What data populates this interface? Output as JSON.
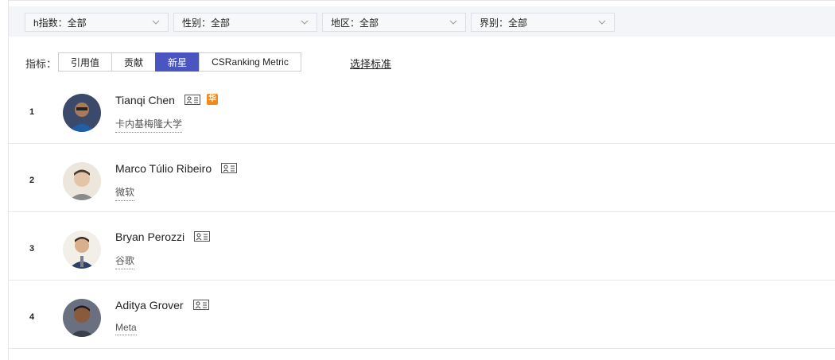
{
  "filters": [
    {
      "label": "h指数：全部"
    },
    {
      "label": "性别：全部"
    },
    {
      "label": "地区：全部"
    },
    {
      "label": "界别：全部"
    }
  ],
  "metric": {
    "label": "指标：",
    "tabs": [
      "引用值",
      "贡献",
      "新星",
      "CSRanking Metric"
    ],
    "active": "新星"
  },
  "choose_label": "选择标准",
  "people": [
    {
      "rank": "1",
      "name": "Tianqi Chen",
      "org": "卡内基梅隆大学",
      "badge": true,
      "badge_text": "华",
      "avatar_color": "#3b4a6b"
    },
    {
      "rank": "2",
      "name": "Marco Túlio Ribeiro",
      "org": "微软",
      "badge": false,
      "avatar_color": "#d8cbbf"
    },
    {
      "rank": "3",
      "name": "Bryan Perozzi",
      "org": "谷歌",
      "badge": false,
      "avatar_color": "#e0ddd6"
    },
    {
      "rank": "4",
      "name": "Aditya Grover",
      "org": "Meta",
      "badge": false,
      "avatar_color": "#6a7080"
    }
  ],
  "colors": {
    "accent": "#4a55c2",
    "badge": "#f08a1c"
  }
}
